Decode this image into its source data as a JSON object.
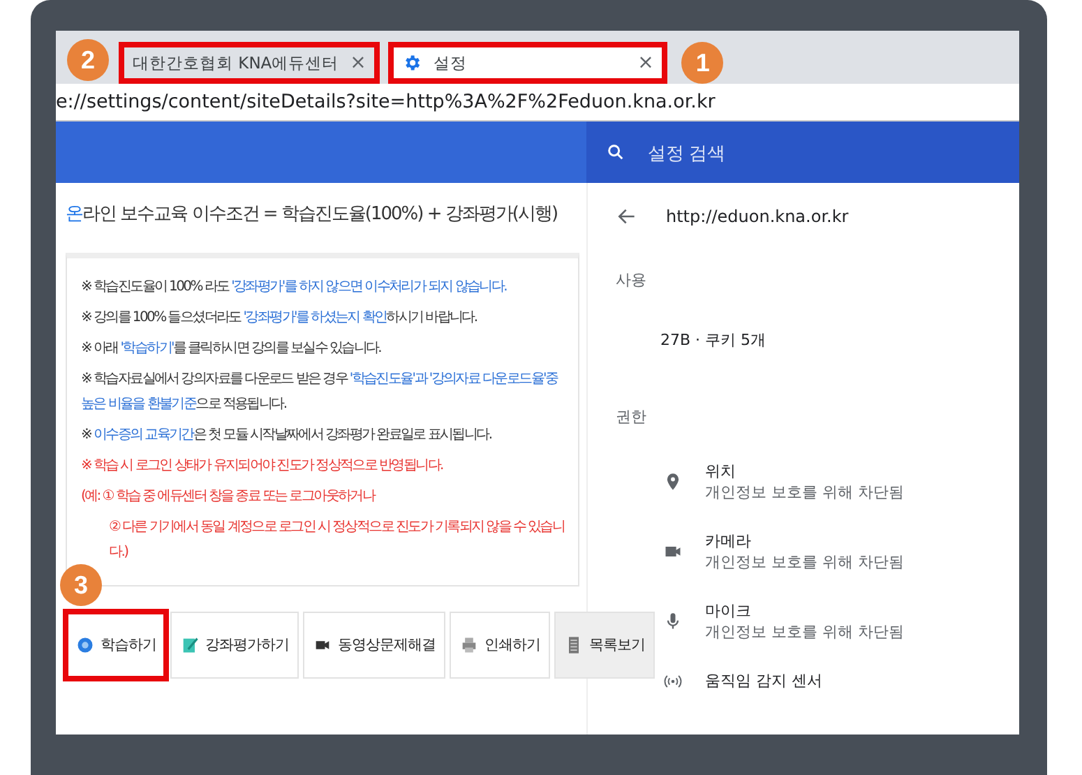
{
  "tabs": [
    {
      "title": "대한간호협회 KNA에듀센터",
      "close": "×",
      "selected": false,
      "highlighted": true,
      "badge": "2"
    },
    {
      "title": "설정",
      "close": "×",
      "selected": true,
      "highlighted": true,
      "badge": "1"
    }
  ],
  "address_bar": {
    "url": "e://settings/content/siteDetails?site=http%3A%2F%2Feduon.kna.or.kr"
  },
  "settings_search": {
    "placeholder": "설정 검색"
  },
  "course_page": {
    "heading": [
      {
        "text": "온",
        "kind": "accent"
      },
      {
        "text": "라인 보수교육 이수조건 = 학습진도율(100%) + 강좌평가(시행)",
        "kind": "plain"
      }
    ],
    "notices": [
      [
        {
          "text": "※ 학습진도율이 100% 라도 ",
          "kind": "plain"
        },
        {
          "text": "'강좌평가'를 하지 않으면 이수처리가 되지 않습니다.",
          "kind": "link"
        }
      ],
      [
        {
          "text": "※ 강의를 100% 들으셨더라도 ",
          "kind": "plain"
        },
        {
          "text": "'강좌평가'를 하셨는지 확인",
          "kind": "link"
        },
        {
          "text": "하시기 바랍니다.",
          "kind": "plain"
        }
      ],
      [
        {
          "text": "※ 아래 ",
          "kind": "plain"
        },
        {
          "text": "'학습하기'",
          "kind": "link"
        },
        {
          "text": "를 클릭하시면 강의를 보실수 있습니다.",
          "kind": "plain"
        }
      ],
      [
        {
          "text": "※ 학습자료실에서 강의자료를 다운로드 받은 경우 ",
          "kind": "plain"
        },
        {
          "text": "'학습진도율'과 '강의자료 다운로드율'중 높은 비율을 환불기준",
          "kind": "link"
        },
        {
          "text": "으로 적용됩니다.",
          "kind": "plain"
        }
      ],
      [
        {
          "text": "※ ",
          "kind": "plain"
        },
        {
          "text": "이수증의 교육기간",
          "kind": "link"
        },
        {
          "text": "은 첫 모듈 시작날짜에서 강좌평가 완료일로 표시됩니다.",
          "kind": "plain"
        }
      ],
      [
        {
          "text": "※ 학습 시 로그인 상태가 유지되어야 진도가 정상적으로 반영됩니다.",
          "kind": "warning"
        }
      ],
      [
        {
          "text": "(예: ① 학습 중 에듀센터 창을 종료 또는 로그아웃하거나",
          "kind": "warning"
        }
      ],
      [
        {
          "text": "② 다른 기기에서 동일 계정으로 로그인 시 정상적으로 진도가 기록되지 않을 수 있습니다.)",
          "kind": "warning_indent"
        }
      ]
    ],
    "buttons": [
      {
        "label": "학습하기",
        "highlighted": true,
        "badge": "3",
        "selected": false
      },
      {
        "label": "강좌평가하기",
        "highlighted": false,
        "selected": false
      },
      {
        "label": "동영상문제해결",
        "highlighted": false,
        "selected": false
      },
      {
        "label": "인쇄하기",
        "highlighted": false,
        "selected": false
      },
      {
        "label": "목록보기",
        "highlighted": false,
        "selected": true
      }
    ]
  },
  "site_details": {
    "url": "http://eduon.kna.or.kr",
    "usage_title": "사용",
    "usage": "27B · 쿠키 5개",
    "permissions_title": "권한",
    "permissions": [
      {
        "name": "위치",
        "status": "개인정보 보호를 위해 차단됨"
      },
      {
        "name": "카메라",
        "status": "개인정보 보호를 위해 차단됨"
      },
      {
        "name": "마이크",
        "status": "개인정보 보호를 위해 차단됨"
      },
      {
        "name": "움직임 감지 센서"
      }
    ]
  }
}
